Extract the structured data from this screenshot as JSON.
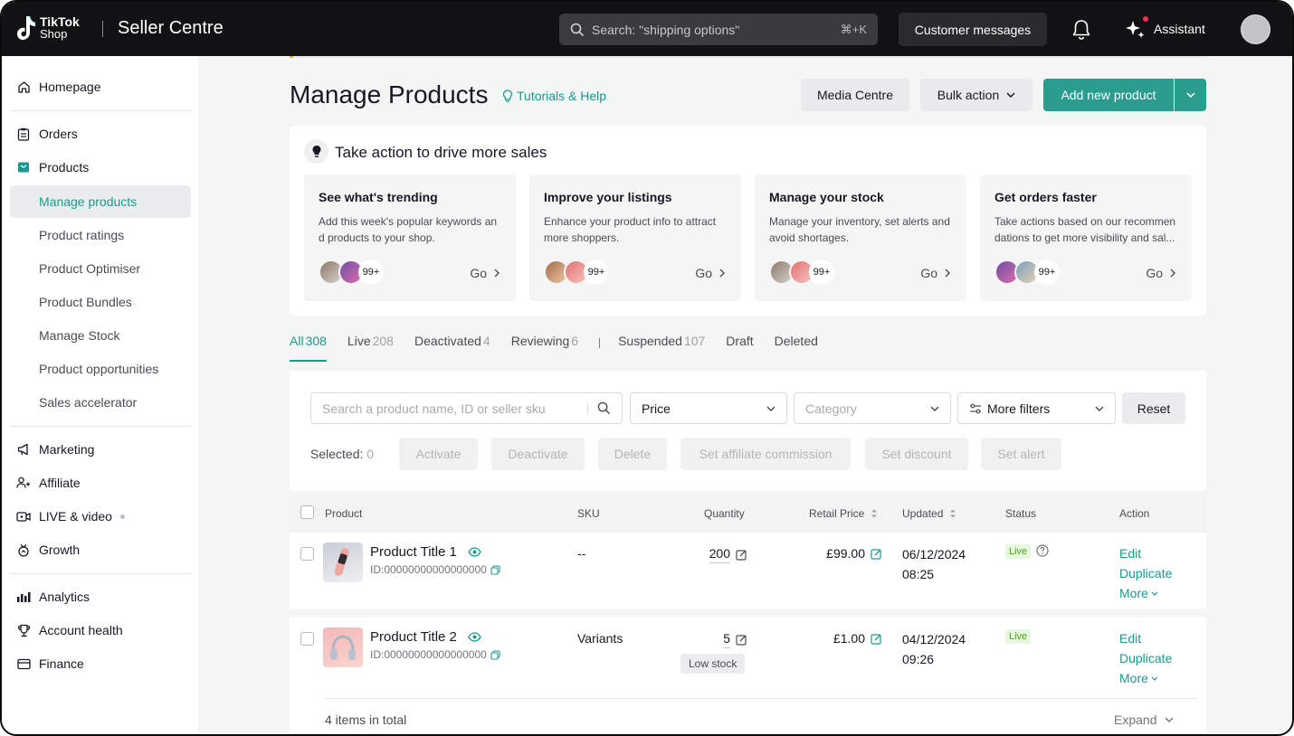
{
  "header": {
    "logo_line1": "TikTok",
    "logo_line2": "Shop",
    "app_name": "Seller Centre",
    "search_placeholder": "Search: \"shipping options\"",
    "search_shortcut": "⌘+K",
    "customer_messages": "Customer messages",
    "assistant": "Assistant"
  },
  "sidebar": {
    "homepage": "Homepage",
    "orders": "Orders",
    "products": "Products",
    "product_items": [
      "Manage products",
      "Product ratings",
      "Product Optimiser",
      "Product Bundles",
      "Manage Stock",
      "Product opportunities",
      "Sales accelerator"
    ],
    "marketing": "Marketing",
    "affiliate": "Affiliate",
    "live_video": "LIVE & video",
    "growth": "Growth",
    "analytics": "Analytics",
    "account_health": "Account health",
    "finance": "Finance"
  },
  "page": {
    "title": "Manage Products",
    "tutorials": "Tutorials & Help",
    "media_centre": "Media Centre",
    "bulk_action": "Bulk action",
    "add_new_product": "Add new product"
  },
  "actions_panel": {
    "title": "Take action to drive more sales",
    "cards": [
      {
        "title": "See what's trending",
        "desc": "Add this week's popular keywords an d products to your shop.",
        "count": "99+",
        "go": "Go"
      },
      {
        "title": "Improve your listings",
        "desc": "Enhance your product info to attract more shoppers.",
        "count": "99+",
        "go": "Go"
      },
      {
        "title": "Manage your stock",
        "desc": "Manage your inventory, set alerts and avoid shortages.",
        "count": "99+",
        "go": "Go"
      },
      {
        "title": "Get orders faster",
        "desc": "Take actions based on our recommen dations to get more visibility and sal...",
        "count": "99+",
        "go": "Go"
      }
    ]
  },
  "tabs": [
    {
      "label": "All",
      "count": "308"
    },
    {
      "label": "Live",
      "count": "208"
    },
    {
      "label": "Deactivated",
      "count": "4"
    },
    {
      "label": "Reviewing",
      "count": "6"
    },
    {
      "label": "Suspended",
      "count": "107"
    },
    {
      "label": "Draft",
      "count": ""
    },
    {
      "label": "Deleted",
      "count": ""
    }
  ],
  "filters": {
    "search_placeholder": "Search a product name, ID or seller sku",
    "price": "Price",
    "category": "Category",
    "more_filters": "More filters",
    "reset": "Reset",
    "selected_label": "Selected:",
    "selected_count": "0",
    "bulk": [
      "Activate",
      "Deactivate",
      "Delete",
      "Set affiliate commission",
      "Set discount",
      "Set alert"
    ]
  },
  "table": {
    "headers": [
      "Product",
      "SKU",
      "Quantity",
      "Retail Price",
      "Updated",
      "Status",
      "Action"
    ],
    "rows": [
      {
        "name": "Product Title 1",
        "id": "ID:00000000000000000",
        "sku": "--",
        "quantity": "200",
        "price": "£99.00",
        "updated_date": "06/12/2024",
        "updated_time": "08:25",
        "status": "Live",
        "edit": "Edit",
        "duplicate": "Duplicate",
        "more": "More"
      },
      {
        "name": "Product Title 2",
        "id": "ID:00000000000000000",
        "sku": "Variants",
        "quantity": "5",
        "stock_badge": "Low stock",
        "price": "£1.00",
        "updated_date": "04/12/2024",
        "updated_time": "09:26",
        "status": "Live",
        "edit": "Edit",
        "duplicate": "Duplicate",
        "more": "More"
      }
    ],
    "total": "4 items in total",
    "expand": "Expand"
  },
  "colors": {
    "accent": "#2a9d8f",
    "topbar": "#111213",
    "live_green": "#49a813"
  }
}
